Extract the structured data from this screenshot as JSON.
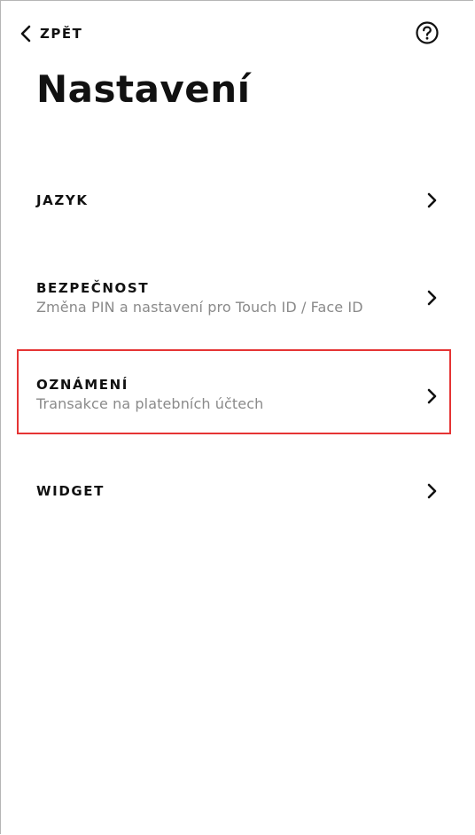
{
  "header": {
    "back_label": "ZPĚT",
    "back_icon": "chevron-left-icon",
    "help_icon": "question-circle-icon"
  },
  "page": {
    "title": "Nastavení"
  },
  "settings": {
    "items": [
      {
        "label": "JAZYK",
        "subtitle": ""
      },
      {
        "label": "BEZPEČNOST",
        "subtitle": "Změna PIN a nastavení pro Touch ID / Face ID"
      },
      {
        "label": "OZNÁMENÍ",
        "subtitle": "Transakce na platebních účtech"
      },
      {
        "label": "WIDGET",
        "subtitle": ""
      }
    ]
  },
  "colors": {
    "highlight_border": "#e53434",
    "text_primary": "#111111",
    "text_secondary": "#8a8a8a"
  }
}
